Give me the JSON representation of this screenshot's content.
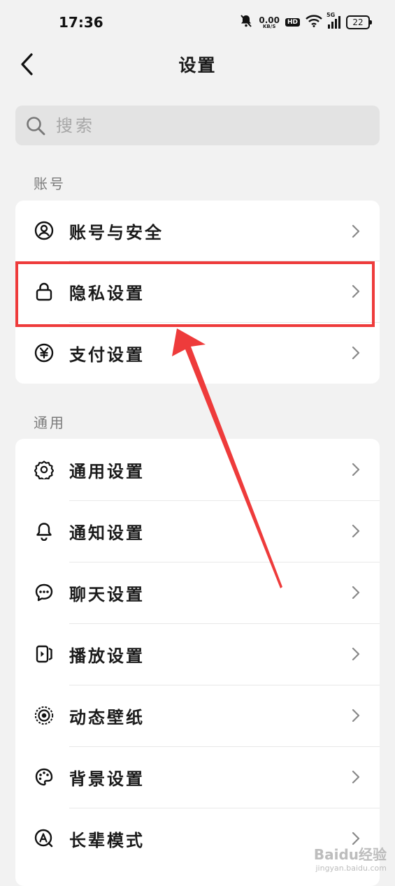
{
  "status_bar": {
    "time": "17:36",
    "net_speed_value": "0.00",
    "net_speed_unit": "KB/S",
    "hd_badge": "HD",
    "network_type": "5G",
    "battery": "22"
  },
  "nav": {
    "title": "设置",
    "back_icon": "chevron-left-icon"
  },
  "search": {
    "placeholder": "搜索",
    "icon": "search-icon"
  },
  "sections": {
    "account": {
      "title": "账号",
      "items": [
        {
          "label": "账号与安全",
          "icon": "user-circle-icon"
        },
        {
          "label": "隐私设置",
          "icon": "lock-icon"
        },
        {
          "label": "支付设置",
          "icon": "yen-circle-icon"
        }
      ]
    },
    "general": {
      "title": "通用",
      "items": [
        {
          "label": "通用设置",
          "icon": "gear-icon"
        },
        {
          "label": "通知设置",
          "icon": "bell-icon"
        },
        {
          "label": "聊天设置",
          "icon": "chat-bubble-icon"
        },
        {
          "label": "播放设置",
          "icon": "play-card-icon"
        },
        {
          "label": "动态壁纸",
          "icon": "live-wallpaper-icon"
        },
        {
          "label": "背景设置",
          "icon": "palette-icon"
        },
        {
          "label": "长辈模式",
          "icon": "elder-mode-icon"
        }
      ]
    }
  },
  "annotation": {
    "highlight_color": "#ee3b3b",
    "highlighted_item": "隐私设置"
  },
  "watermark": {
    "line1": "Baidu经验",
    "line2": "jingyan.baidu.com"
  }
}
